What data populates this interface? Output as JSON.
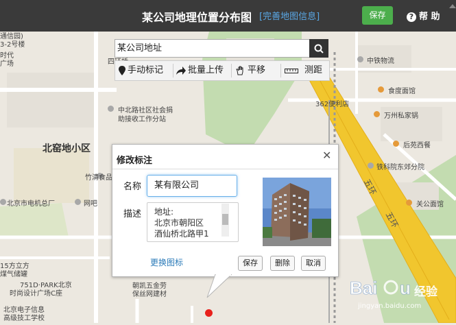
{
  "header": {
    "title": "某公司地理位置分布图",
    "perfect_link": "[完善地图信息]",
    "save_label": "保存",
    "help_icon": "?",
    "help_label": "帮 助"
  },
  "search": {
    "value": "某公司地址"
  },
  "toolbar": {
    "items": [
      {
        "label": "手动标记",
        "icon": "pin-icon"
      },
      {
        "label": "批量上传",
        "icon": "share-arrow-icon"
      },
      {
        "label": "平移",
        "icon": "hand-icon"
      },
      {
        "label": "测距",
        "icon": "ruler-icon"
      }
    ]
  },
  "map": {
    "labels": {
      "tl1": "通信园)",
      "tl2": "3-2号楼",
      "tl3": "时代",
      "tl4": "广场",
      "sihuanqiao": "四环桥",
      "zhonglu": "中北路社区社会捐",
      "zhonglu2": "助接收工作分站",
      "beiyao": "北窑地小区",
      "zhuqing": "竹清食品",
      "dianji": "北京市电机总厂",
      "wangba": "网吧",
      "l15": "15方立方",
      "l15b": "煤气储罐",
      "park1": "751D·PARK北京",
      "park2": "时尚设计广场C座",
      "dianzi1": "北京电子信息",
      "dianzi2": "高级技工学校",
      "wujin1": "朝凯五金劳",
      "wujin2": "保丝网建材",
      "tiewuliu": "中铁物流",
      "shipin": "食度面馆",
      "bianli": "362便利店",
      "wanfu": "万州私家锅",
      "houhua": "后苑西餐",
      "tieke": "铁科院东郊分院",
      "guangong": "关公面馆",
      "wuhuan1": "五环",
      "wuhuan2": "五环"
    }
  },
  "dialog": {
    "title": "修改标注",
    "name_label": "名称",
    "name_value": "某有限公司",
    "desc_label": "描述",
    "desc_lines": [
      "地址:",
      "北京市朝阳区",
      "酒仙桥北路甲1"
    ],
    "change_icon": "更换图标",
    "save": "保存",
    "delete": "删除",
    "cancel": "取消"
  },
  "watermark": {
    "brand_text": "经验",
    "url": "jingyan.baidu.com"
  },
  "colors": {
    "topbar": "#3a3a3a",
    "save_green": "#4cae4c",
    "road_yellow": "#f1c62e",
    "green_area": "#c3dcb0",
    "marker_red": "#e8211c"
  }
}
